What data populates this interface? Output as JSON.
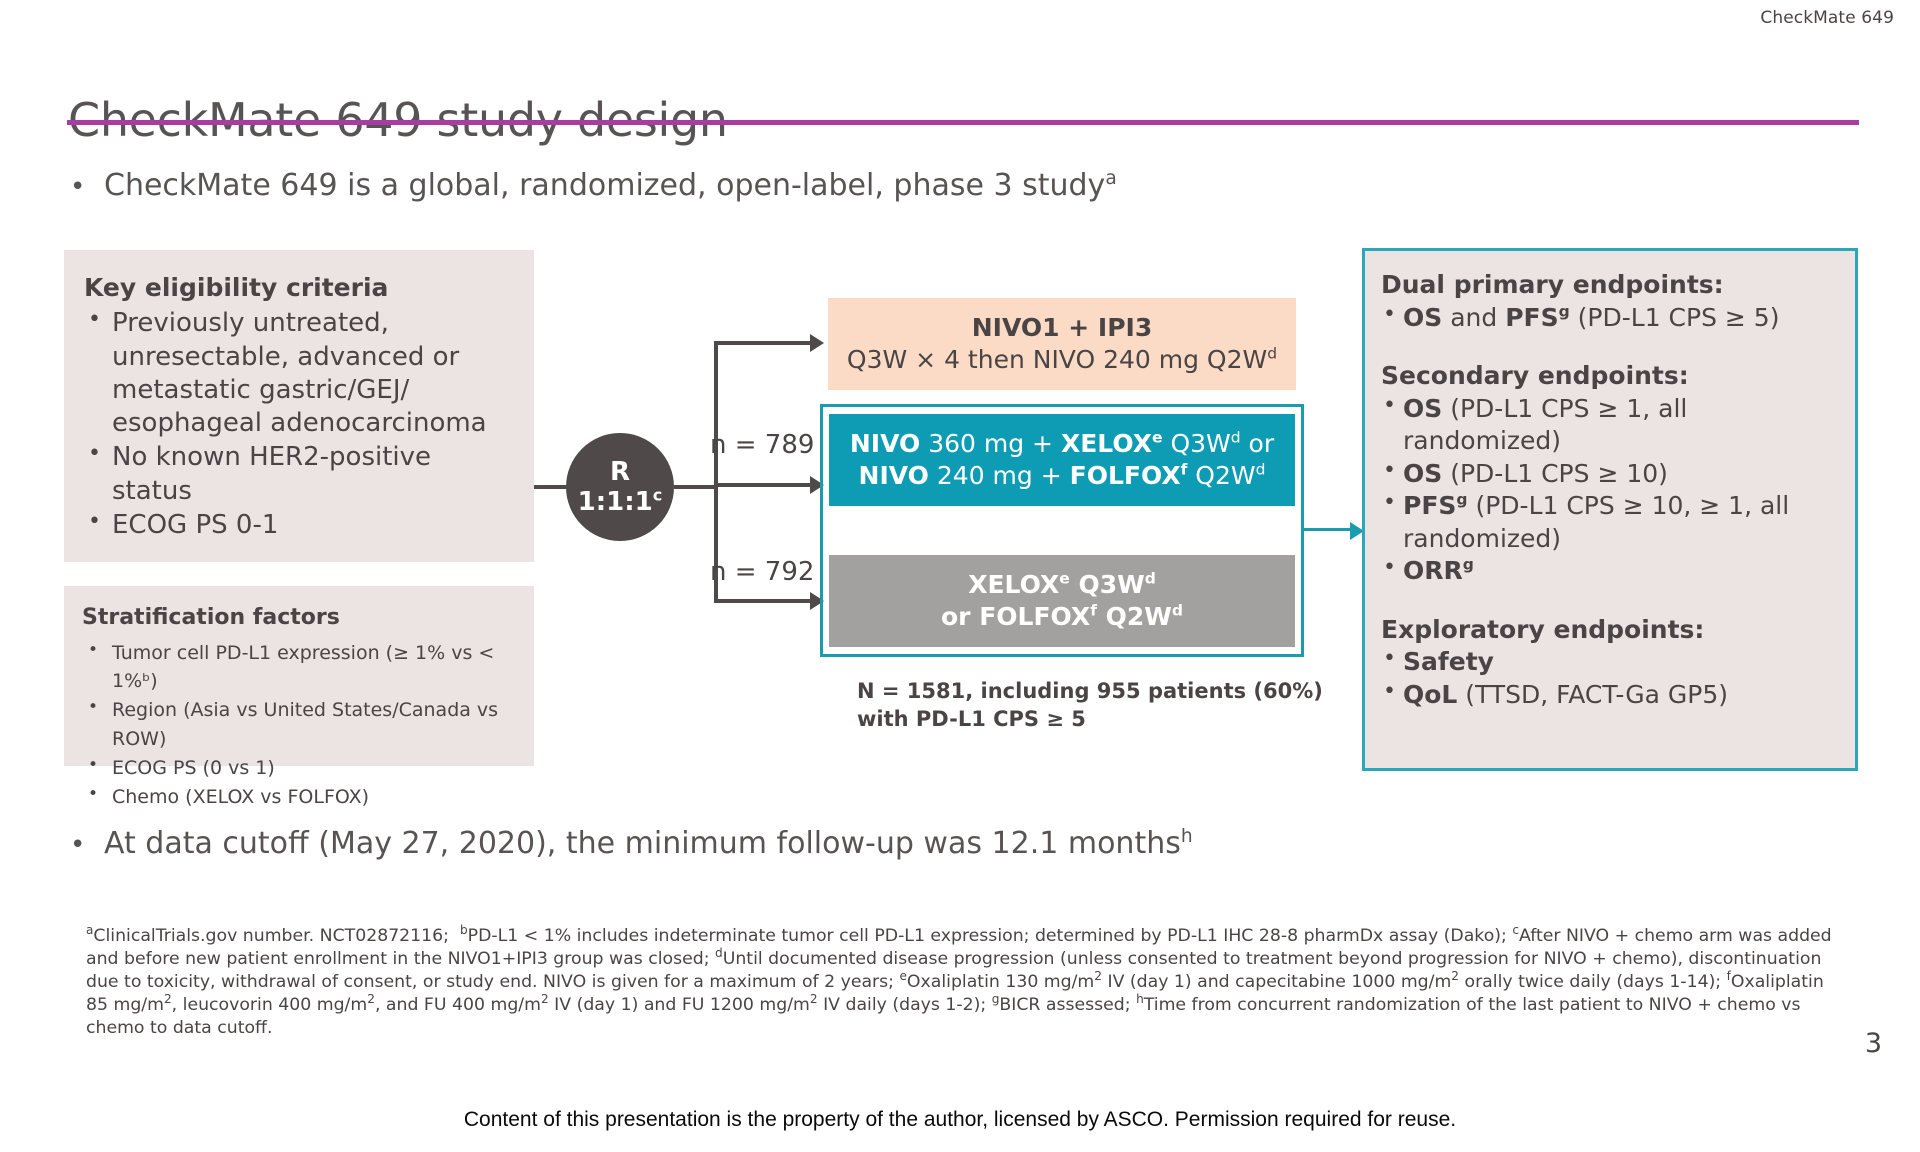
{
  "header": {
    "study_label": "CheckMate 649",
    "title": "CheckMate 649 study design",
    "rule_color": "#a83ca3"
  },
  "bullets": {
    "top_text": "CheckMate 649 is a global, randomized, open-label, phase 3 study",
    "top_superscript": "a",
    "bottom_text": "At data cutoff (May 27, 2020), the minimum follow-up was 12.1 months",
    "bottom_superscript": "h"
  },
  "eligibility": {
    "heading": "Key eligibility criteria",
    "items": [
      "Previously untreated, unresectable, advanced or metastatic gastric/GEJ/ esophageal adenocarcinoma",
      "No known HER2-positive status",
      "ECOG PS 0-1"
    ]
  },
  "stratification": {
    "heading": "Stratification factors",
    "items": [
      "Tumor cell PD-L1 expression (≥ 1% vs < 1%ᵇ)",
      "Region (Asia vs United States/Canada vs ROW)",
      "ECOG PS (0 vs 1)",
      "Chemo (XELOX vs FOLFOX)"
    ]
  },
  "randomization": {
    "letter": "R",
    "ratio": "1:1:1",
    "ratio_superscript": "c",
    "n_upper": "n = 789",
    "n_lower": "n = 792",
    "circle_color": "#4f4a49"
  },
  "arms": {
    "nivo_ipi": {
      "line1_bold": "NIVO",
      "line1_rest": "1 + ",
      "line1_bold2": "IPI",
      "line1_rest2": "3",
      "line1_plain": "NIVO1 + IPI3",
      "line2": "Q3W × 4 then NIVO 240 mg Q2W",
      "line2_superscript": "d",
      "bg_color": "#fbdbc5"
    },
    "nivo_chemo": {
      "line1_a": "NIVO",
      "line1_b": " 360 mg + ",
      "line1_c": "XELOX",
      "line1_c_sup": "e",
      "line1_d": " Q3W",
      "line1_d_sup": "d",
      "line1_e": " or",
      "line2_a": "NIVO",
      "line2_b": " 240 mg + ",
      "line2_c": "FOLFOX",
      "line2_c_sup": "f",
      "line2_d": " Q2W",
      "line2_d_sup": "d",
      "bg_color": "#0e9cb5"
    },
    "chemo": {
      "line1": "XELOX",
      "line1_sup": "e",
      "line1_b": " Q3W",
      "line1_b_sup": "d",
      "line2": "or FOLFOX",
      "line2_sup": "f",
      "line2_b": " Q2W",
      "line2_b_sup": "d",
      "bg_color": "#a3a0a0"
    },
    "total_note_line1": "N = 1581, including 955 patients (60%)",
    "total_note_line2": "with PD-L1 CPS ≥ 5"
  },
  "endpoints": {
    "border_color": "#2ba7bb",
    "primary_heading": "Dual primary endpoints:",
    "primary_items_html": [
      "<b>OS</b> and <b>PFS<sup>g</sup></b> (PD-L1 CPS ≥ 5)"
    ],
    "secondary_heading": "Secondary endpoints:",
    "secondary_items_html": [
      "<b>OS</b> (PD-L1 CPS ≥ 1, all randomized)",
      "<b>OS</b> (PD-L1 CPS ≥ 10)",
      "<b>PFS<sup>g</sup></b> (PD-L1 CPS ≥ 10, ≥ 1, all randomized)",
      "<b>ORR<sup>g</sup></b>"
    ],
    "exploratory_heading": "Exploratory endpoints:",
    "exploratory_items_html": [
      "<b>Safety</b>",
      "<b>QoL</b> (TTSD, FACT-Ga GP5)"
    ]
  },
  "footnotes_html": "<sup>a</sup>ClinicalTrials.gov number. NCT02872116;&nbsp; <sup>b</sup>PD-L1 &lt; 1% includes indeterminate tumor cell PD-L1 expression; determined by PD-L1 IHC 28-8 pharmDx assay (Dako); <sup>c</sup>After NIVO + chemo arm was added and before new patient enrollment in the NIVO1+IPI3 group was closed; <sup>d</sup>Until documented disease progression (unless consented to treatment beyond progression for NIVO + chemo), discontinuation due to toxicity, withdrawal of consent, or study end. NIVO is given for a maximum of 2 years; <sup>e</sup>Oxaliplatin 130 mg/m<sup>2</sup> IV (day 1) and capecitabine 1000 mg/m<sup>2</sup> orally twice daily (days 1-14); <sup>f</sup>Oxaliplatin 85 mg/m<sup>2</sup>, leucovorin 400 mg/m<sup>2</sup>, and FU 400 mg/m<sup>2</sup> IV (day 1) and FU 1200 mg/m<sup>2</sup> IV daily (days 1-2); <sup>g</sup>BICR assessed; <sup>h</sup>Time from concurrent randomization of the last patient to NIVO + chemo vs chemo to data cutoff.",
  "page_number": "3",
  "copyright": "Content of this presentation is the property of the author, licensed by ASCO. Permission required for reuse."
}
